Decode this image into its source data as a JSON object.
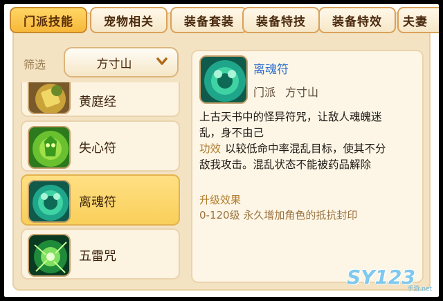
{
  "tabs": [
    {
      "label": "门派技能",
      "active": true
    },
    {
      "label": "宠物相关",
      "active": false
    },
    {
      "label": "装备套装",
      "active": false
    },
    {
      "label": "装备特技",
      "active": false
    },
    {
      "label": "装备特效",
      "active": false
    },
    {
      "label": "夫妻",
      "active": false
    }
  ],
  "filter": {
    "label": "筛选",
    "value": "方寸山",
    "icon": "chevron-down-icon"
  },
  "skills": [
    {
      "name": "黄庭经",
      "icon": "tome-icon"
    },
    {
      "name": "失心符",
      "icon": "green-spirit-icon"
    },
    {
      "name": "离魂符",
      "icon": "jade-talisman-icon",
      "selected": true
    },
    {
      "name": "五雷咒",
      "icon": "thunder-orb-icon"
    }
  ],
  "detail": {
    "name": "离魂符",
    "school_label": "门派",
    "school_value": "方寸山",
    "desc_line1": "上古天书中的怪异符咒，让敌人魂魄迷",
    "desc_line2": "乱，身不由己",
    "effect_label": "功效",
    "effect_line1": "以较低命中率混乱目标，使其不分",
    "effect_line2": "敌我攻击。混乱状态不能被药品解除",
    "upgrade_title": "升级效果",
    "upgrade_text": "0-120级 永久增加角色的抵抗封印"
  },
  "watermark": {
    "main": "SY123",
    "sub": "手游.net"
  },
  "colors": {
    "accent_tab": "#f7b83a",
    "skill_name_blue": "#2f6fd0",
    "label_gold": "#b07b2c"
  }
}
